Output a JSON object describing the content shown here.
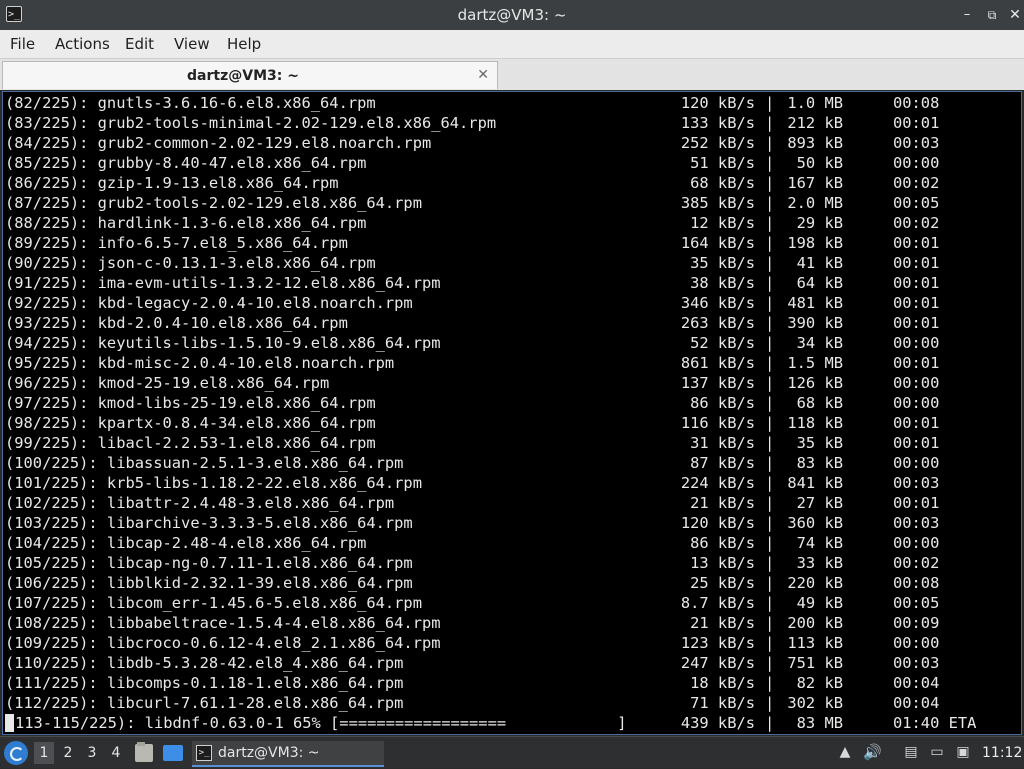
{
  "window": {
    "title": "dartz@VM3: ~",
    "app_icon": ">_",
    "controls": {
      "minimize": "–",
      "maximize": "⧉",
      "close": "✕"
    }
  },
  "menubar": {
    "file": "File",
    "actions": "Actions",
    "edit": "Edit",
    "view": "View",
    "help": "Help"
  },
  "tab": {
    "label": "dartz@VM3: ~",
    "close": "✕"
  },
  "terminal": {
    "lines": [
      {
        "name": "(82/225): gnutls-3.6.16-6.el8.x86_64.rpm",
        "speed": "120 kB/s",
        "size": "1.0 MB",
        "time": "00:08"
      },
      {
        "name": "(83/225): grub2-tools-minimal-2.02-129.el8.x86_64.rpm",
        "speed": "133 kB/s",
        "size": "212 kB",
        "time": "00:01"
      },
      {
        "name": "(84/225): grub2-common-2.02-129.el8.noarch.rpm",
        "speed": "252 kB/s",
        "size": "893 kB",
        "time": "00:03"
      },
      {
        "name": "(85/225): grubby-8.40-47.el8.x86_64.rpm",
        "speed": "51 kB/s",
        "size": "50 kB",
        "time": "00:00"
      },
      {
        "name": "(86/225): gzip-1.9-13.el8.x86_64.rpm",
        "speed": "68 kB/s",
        "size": "167 kB",
        "time": "00:02"
      },
      {
        "name": "(87/225): grub2-tools-2.02-129.el8.x86_64.rpm",
        "speed": "385 kB/s",
        "size": "2.0 MB",
        "time": "00:05"
      },
      {
        "name": "(88/225): hardlink-1.3-6.el8.x86_64.rpm",
        "speed": "12 kB/s",
        "size": "29 kB",
        "time": "00:02"
      },
      {
        "name": "(89/225): info-6.5-7.el8_5.x86_64.rpm",
        "speed": "164 kB/s",
        "size": "198 kB",
        "time": "00:01"
      },
      {
        "name": "(90/225): json-c-0.13.1-3.el8.x86_64.rpm",
        "speed": "35 kB/s",
        "size": "41 kB",
        "time": "00:01"
      },
      {
        "name": "(91/225): ima-evm-utils-1.3.2-12.el8.x86_64.rpm",
        "speed": "38 kB/s",
        "size": "64 kB",
        "time": "00:01"
      },
      {
        "name": "(92/225): kbd-legacy-2.0.4-10.el8.noarch.rpm",
        "speed": "346 kB/s",
        "size": "481 kB",
        "time": "00:01"
      },
      {
        "name": "(93/225): kbd-2.0.4-10.el8.x86_64.rpm",
        "speed": "263 kB/s",
        "size": "390 kB",
        "time": "00:01"
      },
      {
        "name": "(94/225): keyutils-libs-1.5.10-9.el8.x86_64.rpm",
        "speed": "52 kB/s",
        "size": "34 kB",
        "time": "00:00"
      },
      {
        "name": "(95/225): kbd-misc-2.0.4-10.el8.noarch.rpm",
        "speed": "861 kB/s",
        "size": "1.5 MB",
        "time": "00:01"
      },
      {
        "name": "(96/225): kmod-25-19.el8.x86_64.rpm",
        "speed": "137 kB/s",
        "size": "126 kB",
        "time": "00:00"
      },
      {
        "name": "(97/225): kmod-libs-25-19.el8.x86_64.rpm",
        "speed": "86 kB/s",
        "size": "68 kB",
        "time": "00:00"
      },
      {
        "name": "(98/225): kpartx-0.8.4-34.el8.x86_64.rpm",
        "speed": "116 kB/s",
        "size": "118 kB",
        "time": "00:01"
      },
      {
        "name": "(99/225): libacl-2.2.53-1.el8.x86_64.rpm",
        "speed": "31 kB/s",
        "size": "35 kB",
        "time": "00:01"
      },
      {
        "name": "(100/225): libassuan-2.5.1-3.el8.x86_64.rpm",
        "speed": "87 kB/s",
        "size": "83 kB",
        "time": "00:00"
      },
      {
        "name": "(101/225): krb5-libs-1.18.2-22.el8.x86_64.rpm",
        "speed": "224 kB/s",
        "size": "841 kB",
        "time": "00:03"
      },
      {
        "name": "(102/225): libattr-2.4.48-3.el8.x86_64.rpm",
        "speed": "21 kB/s",
        "size": "27 kB",
        "time": "00:01"
      },
      {
        "name": "(103/225): libarchive-3.3.3-5.el8.x86_64.rpm",
        "speed": "120 kB/s",
        "size": "360 kB",
        "time": "00:03"
      },
      {
        "name": "(104/225): libcap-2.48-4.el8.x86_64.rpm",
        "speed": "86 kB/s",
        "size": "74 kB",
        "time": "00:00"
      },
      {
        "name": "(105/225): libcap-ng-0.7.11-1.el8.x86_64.rpm",
        "speed": "13 kB/s",
        "size": "33 kB",
        "time": "00:02"
      },
      {
        "name": "(106/225): libblkid-2.32.1-39.el8.x86_64.rpm",
        "speed": "25 kB/s",
        "size": "220 kB",
        "time": "00:08"
      },
      {
        "name": "(107/225): libcom_err-1.45.6-5.el8.x86_64.rpm",
        "speed": "8.7 kB/s",
        "size": "49 kB",
        "time": "00:05"
      },
      {
        "name": "(108/225): libbabeltrace-1.5.4-4.el8.x86_64.rpm",
        "speed": "21 kB/s",
        "size": "200 kB",
        "time": "00:09"
      },
      {
        "name": "(109/225): libcroco-0.6.12-4.el8_2.1.x86_64.rpm",
        "speed": "123 kB/s",
        "size": "113 kB",
        "time": "00:00"
      },
      {
        "name": "(110/225): libdb-5.3.28-42.el8_4.x86_64.rpm",
        "speed": "247 kB/s",
        "size": "751 kB",
        "time": "00:03"
      },
      {
        "name": "(111/225): libcomps-0.1.18-1.el8.x86_64.rpm",
        "speed": "18 kB/s",
        "size": "82 kB",
        "time": "00:04"
      },
      {
        "name": "(112/225): libcurl-7.61.1-28.el8.x86_64.rpm",
        "speed": "71 kB/s",
        "size": "302 kB",
        "time": "00:04"
      }
    ],
    "progress": {
      "prefix": "113-115/225): libdnf-0.63.0-1 65% [==================            ]",
      "speed": "439 kB/s",
      "size": "83 MB",
      "time": "01:40 ETA",
      "percent": 65
    }
  },
  "taskbar": {
    "workspaces": [
      "1",
      "2",
      "3",
      "4"
    ],
    "active_workspace": "1",
    "task_label": "dartz@VM3: ~",
    "clock": "11:12"
  },
  "colors": {
    "terminal_bg": "#000000",
    "terminal_fg": "#e8e8e8",
    "titlebar_bg": "#3c3f41",
    "taskbar_bg": "#2e2f30",
    "accent": "#2f7dd1"
  }
}
